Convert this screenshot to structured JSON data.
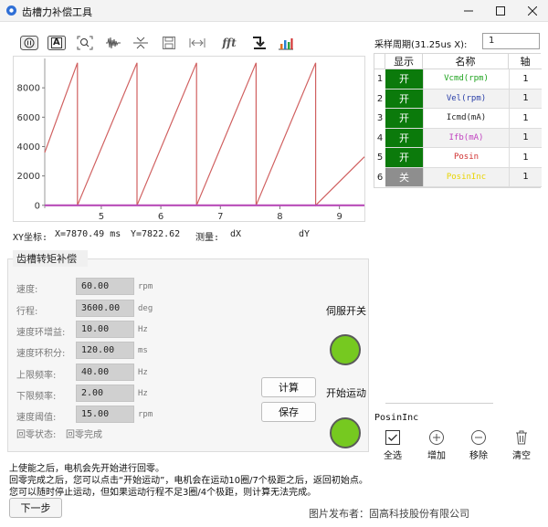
{
  "window": {
    "title": "齿槽力补偿工具",
    "controls": [
      "minimize",
      "maximize",
      "close"
    ]
  },
  "toolbar": {
    "tools": [
      {
        "name": "pause-icon"
      },
      {
        "name": "auto-scale-icon",
        "label": "A"
      },
      {
        "name": "zoom-box-icon"
      },
      {
        "name": "waveform-icon"
      },
      {
        "name": "compress-icon"
      },
      {
        "name": "save-icon"
      },
      {
        "name": "fit-width-icon"
      },
      {
        "name": "fft-icon",
        "label": "fft"
      },
      {
        "name": "step-arrow-icon"
      },
      {
        "name": "bar-chart-icon"
      }
    ]
  },
  "chart_data": {
    "type": "line",
    "xlim": [
      4.05,
      9.42
    ],
    "ylim": [
      -200,
      10000
    ],
    "xticks": [
      "5",
      "6",
      "7",
      "8",
      "9"
    ],
    "yticks": [
      "0",
      "2000",
      "4000",
      "6000",
      "8000"
    ],
    "series": [
      {
        "name": "Posin",
        "color": "#d06060",
        "x": [
          4.05,
          4.6,
          4.6,
          5.6,
          5.6,
          6.6,
          6.6,
          7.6,
          7.6,
          8.6,
          8.6,
          9.42
        ],
        "y": [
          3600,
          9700,
          0,
          9700,
          0,
          9700,
          0,
          9700,
          0,
          9700,
          0,
          3300
        ]
      },
      {
        "name": "Ifb(mA)",
        "color": "#b84cb8",
        "x": [
          4.05,
          9.42
        ],
        "y": [
          0,
          0
        ]
      }
    ]
  },
  "readout": {
    "xy_label": "XY坐标:",
    "x_value": "X=7870.49 ms",
    "y_value": "Y=7822.62",
    "measure_label": "测量:",
    "dx_label": "dX",
    "dy_label": "dY"
  },
  "panel": {
    "title": "齿槽转矩补偿",
    "fields": [
      {
        "label": "速度:",
        "value": "60.00",
        "unit": "rpm"
      },
      {
        "label": "行程:",
        "value": "3600.00",
        "unit": "deg"
      },
      {
        "label": "速度环增益:",
        "value": "10.00",
        "unit": "Hz"
      },
      {
        "label": "速度环积分:",
        "value": "120.00",
        "unit": "ms"
      },
      {
        "label": "上限频率:",
        "value": "40.00",
        "unit": "Hz"
      },
      {
        "label": "下限频率:",
        "value": "2.00",
        "unit": "Hz"
      },
      {
        "label": "速度阈值:",
        "value": "15.00",
        "unit": "rpm"
      }
    ],
    "return_state_label": "回零状态:",
    "return_state_value": "回零完成",
    "calc_button": "计算",
    "save_button": "保存",
    "servo_switch_label": "伺服开关",
    "start_motion_label": "开始运动",
    "led_color": "#76c920"
  },
  "sampling": {
    "label": "采样周期(31.25us X):",
    "value": "1"
  },
  "channels": {
    "headers": [
      "显示",
      "名称",
      "轴"
    ],
    "rows": [
      {
        "index": "1",
        "show": "开",
        "name": "Vcmd(rpm)",
        "axis": "1",
        "on": true,
        "color": "#1fa31f"
      },
      {
        "index": "2",
        "show": "开",
        "name": "Vel(rpm)",
        "axis": "1",
        "on": true,
        "color": "#2a3fa8"
      },
      {
        "index": "3",
        "show": "开",
        "name": "Icmd(mA)",
        "axis": "1",
        "on": true,
        "color": "#222222"
      },
      {
        "index": "4",
        "show": "开",
        "name": "Ifb(mA)",
        "axis": "1",
        "on": true,
        "color": "#c040c0"
      },
      {
        "index": "5",
        "show": "开",
        "name": "Posin",
        "axis": "1",
        "on": true,
        "color": "#d03030"
      },
      {
        "index": "6",
        "show": "关",
        "name": "PosinInc",
        "axis": "1",
        "on": false,
        "color": "#e8d400"
      }
    ],
    "on_color": "#0b7a0b",
    "off_color": "#8e8e8e"
  },
  "selected_channel": "PosinInc",
  "actions": [
    {
      "name": "select-all",
      "label": "全选"
    },
    {
      "name": "add",
      "label": "增加"
    },
    {
      "name": "remove",
      "label": "移除"
    },
    {
      "name": "clear",
      "label": "清空"
    }
  ],
  "messages": [
    "上使能之后，电机会先开始进行回零。",
    "回零完成之后，您可以点击“开始运动”，电机会在运动10圈/7个极距之后，返回初始点。",
    "您可以随时停止运动，但如果运动行程不足3圈/4个极距，则计算无法完成。"
  ],
  "next_button": "下一步",
  "watermark": "图片发布者：固高科技股份有限公司"
}
